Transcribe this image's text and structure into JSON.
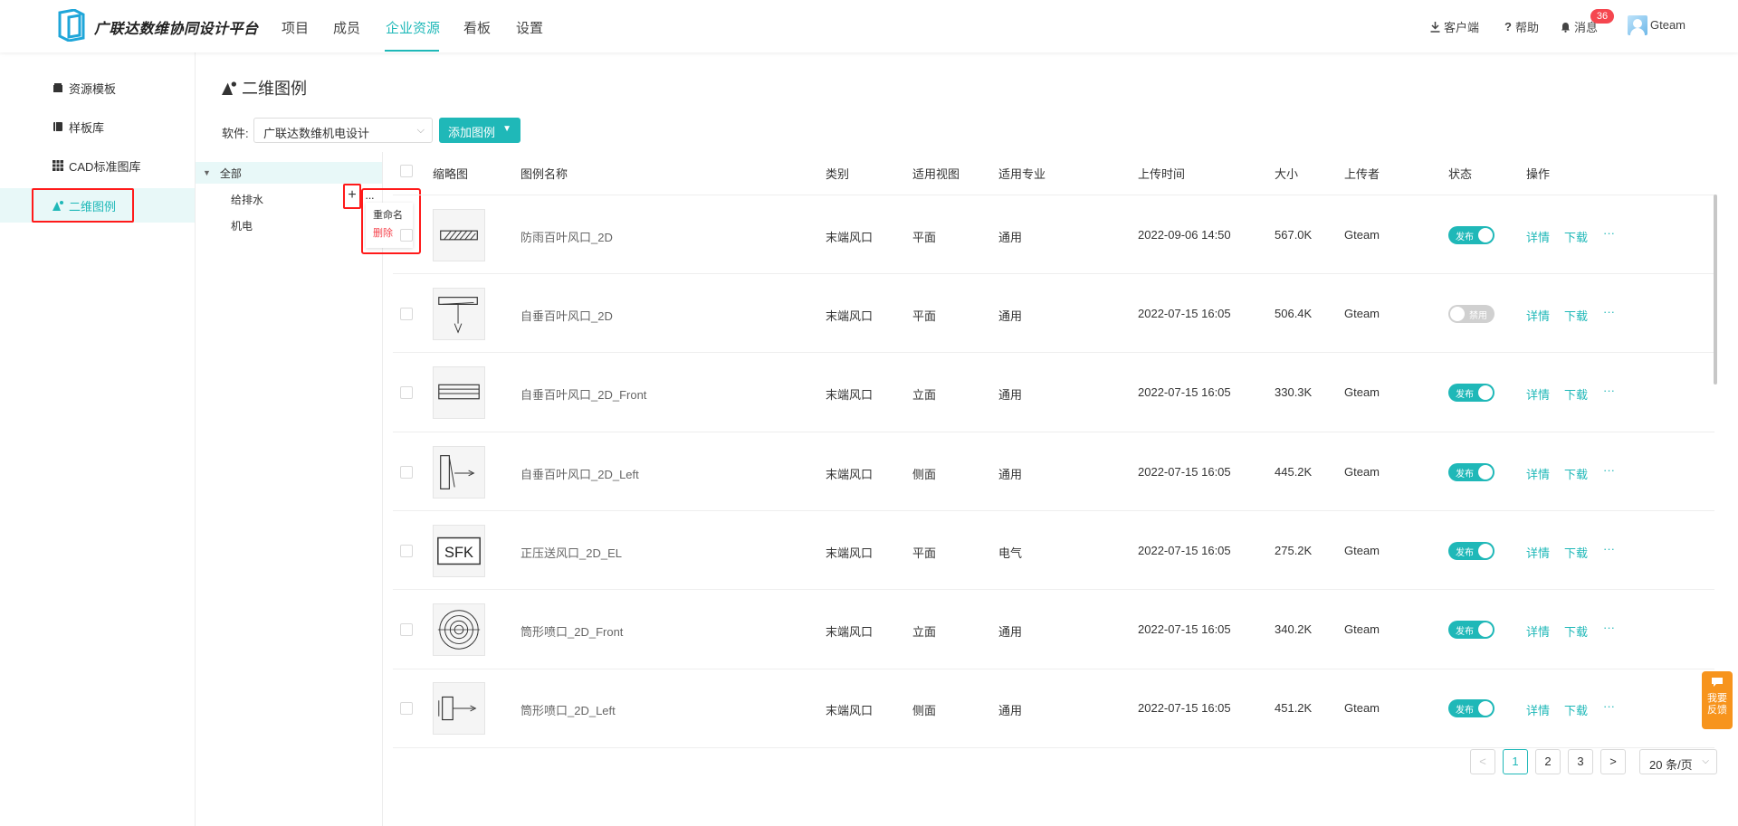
{
  "header": {
    "logo_text": "广联达数维协同设计平台",
    "nav": [
      {
        "label": "项目"
      },
      {
        "label": "成员"
      },
      {
        "label": "企业资源"
      },
      {
        "label": "看板"
      },
      {
        "label": "设置"
      }
    ],
    "client_label": "客户端",
    "help_label": "帮助",
    "message_label": "消息",
    "message_count": "36",
    "user_name": "Gteam"
  },
  "sidebar": {
    "items": [
      {
        "label": "资源模板",
        "icon": "box-icon"
      },
      {
        "label": "样板库",
        "icon": "book-icon"
      },
      {
        "label": "CAD标准图库",
        "icon": "grid-icon"
      },
      {
        "label": "二维图例",
        "icon": "shapes-icon"
      }
    ]
  },
  "page": {
    "title": "二维图例",
    "software_label": "软件:",
    "software_value": "广联达数维机电设计",
    "add_button": "添加图例"
  },
  "tree": {
    "root": "全部",
    "children": [
      "给排水",
      "机电"
    ],
    "menu": [
      "重命名",
      "删除"
    ]
  },
  "table": {
    "columns": [
      "缩略图",
      "图例名称",
      "类别",
      "适用视图",
      "适用专业",
      "上传时间",
      "大小",
      "上传者",
      "状态",
      "操作"
    ],
    "rows": [
      {
        "name": "防雨百叶风口_2D",
        "category": "末端风口",
        "view": "平面",
        "discipline": "通用",
        "time": "2022-09-06 14:50",
        "size": "567.0K",
        "uploader": "Gteam",
        "status": "发布",
        "on": true,
        "thumb": "louver"
      },
      {
        "name": "自垂百叶风口_2D",
        "category": "末端风口",
        "view": "平面",
        "discipline": "通用",
        "time": "2022-07-15 16:05",
        "size": "506.4K",
        "uploader": "Gteam",
        "status": "禁用",
        "on": false,
        "thumb": "hang"
      },
      {
        "name": "自垂百叶风口_2D_Front",
        "category": "末端风口",
        "view": "立面",
        "discipline": "通用",
        "time": "2022-07-15 16:05",
        "size": "330.3K",
        "uploader": "Gteam",
        "status": "发布",
        "on": true,
        "thumb": "front"
      },
      {
        "name": "自垂百叶风口_2D_Left",
        "category": "末端风口",
        "view": "侧面",
        "discipline": "通用",
        "time": "2022-07-15 16:05",
        "size": "445.2K",
        "uploader": "Gteam",
        "status": "发布",
        "on": true,
        "thumb": "left"
      },
      {
        "name": "正压送风口_2D_EL",
        "category": "末端风口",
        "view": "平面",
        "discipline": "电气",
        "time": "2022-07-15 16:05",
        "size": "275.2K",
        "uploader": "Gteam",
        "status": "发布",
        "on": true,
        "thumb": "sfk"
      },
      {
        "name": "筒形喷口_2D_Front",
        "category": "末端风口",
        "view": "立面",
        "discipline": "通用",
        "time": "2022-07-15 16:05",
        "size": "340.2K",
        "uploader": "Gteam",
        "status": "发布",
        "on": true,
        "thumb": "circle"
      },
      {
        "name": "筒形喷口_2D_Left",
        "category": "末端风口",
        "view": "侧面",
        "discipline": "通用",
        "time": "2022-07-15 16:05",
        "size": "451.2K",
        "uploader": "Gteam",
        "status": "发布",
        "on": true,
        "thumb": "nozzle"
      }
    ],
    "actions": {
      "detail": "详情",
      "download": "下载",
      "more": "···"
    },
    "thumb_text_sfk": "SFK"
  },
  "pagination": {
    "pages": [
      "1",
      "2",
      "3"
    ],
    "current": "1",
    "prev": "<",
    "next": ">",
    "page_size": "20 条/页"
  },
  "feedback": "我要反馈",
  "colors": {
    "accent": "#1fb8b8",
    "highlight": "#ff1a1a",
    "badge": "#f5464f",
    "feedback": "#f7941d"
  }
}
